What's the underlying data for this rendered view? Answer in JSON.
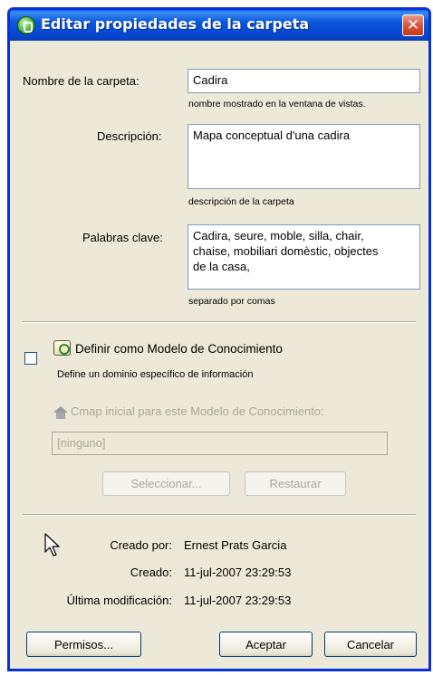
{
  "window": {
    "title": "Editar propiedades de la carpeta",
    "close_glyph": "✕"
  },
  "folder_name": {
    "label": "Nombre de la carpeta:",
    "value": "Cadira",
    "hint": "nombre mostrado en la ventana de vistas."
  },
  "description": {
    "label": "Descripción:",
    "value": "Mapa conceptual d'una cadira",
    "hint": "descripción de la carpeta"
  },
  "keywords": {
    "label": "Palabras clave:",
    "value": "Cadira, seure, moble, silla, chair,\nchaise, mobiliari domèstic, objectes\nde la casa,",
    "hint": "separado por comas"
  },
  "knowledge_model": {
    "checked": false,
    "checkbox_label": "Definir como Modelo de Conocimiento",
    "description": "Define un dominio específico de información",
    "initial_cmap_label": "Cmap inicial para este Modelo de Conocimiento:",
    "initial_cmap_value": "[ninguno]",
    "select_button": "Seleccionar...",
    "restore_button": "Restaurar"
  },
  "info": {
    "created_by_label": "Creado por:",
    "created_by_value": "Ernest Prats Garcia",
    "created_label": "Creado:",
    "created_value": "11-jul-2007 23:29:53",
    "modified_label": "Última modificación:",
    "modified_value": "11-jul-2007 23:29:53"
  },
  "buttons": {
    "permissions": "Permisos...",
    "accept": "Aceptar",
    "cancel": "Cancelar"
  },
  "colors": {
    "titlebar": "#0a57dc",
    "dialog_bg": "#ece9d8",
    "close_button": "#d9553a"
  }
}
